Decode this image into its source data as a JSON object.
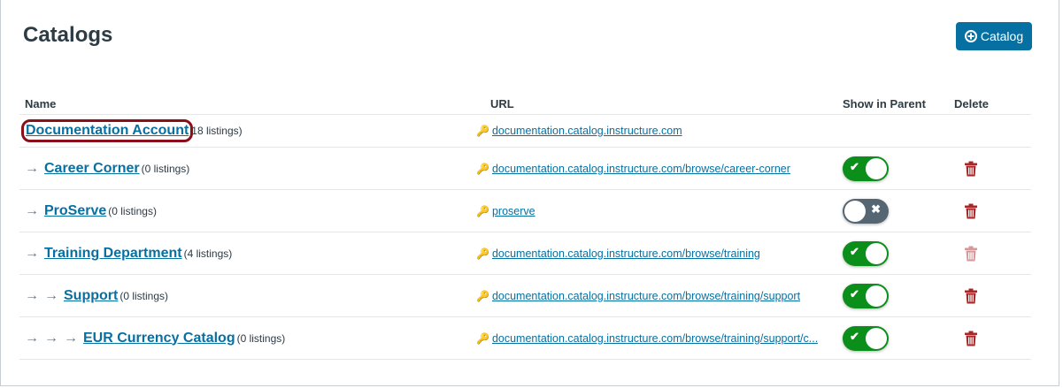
{
  "page": {
    "title": "Catalogs",
    "add_button": "Catalog"
  },
  "columns": {
    "name": "Name",
    "url": "URL",
    "show": "Show in Parent",
    "delete": "Delete"
  },
  "rows": [
    {
      "depth": 0,
      "name": "Documentation Account",
      "count": "18 listings)",
      "url": "documentation.catalog.instructure.com",
      "toggle": null,
      "delete": false
    },
    {
      "depth": 1,
      "name": "Career Corner",
      "count": "(0 listings)",
      "url": "documentation.catalog.instructure.com/browse/career-corner",
      "toggle": true,
      "delete": true
    },
    {
      "depth": 1,
      "name": "ProServe",
      "count": "(0 listings)",
      "url": "proserve",
      "toggle": false,
      "delete": true
    },
    {
      "depth": 1,
      "name": "Training Department",
      "count": "(4 listings)",
      "url": "documentation.catalog.instructure.com/browse/training",
      "toggle": true,
      "delete": "disabled"
    },
    {
      "depth": 2,
      "name": "Support",
      "count": "(0 listings)",
      "url": "documentation.catalog.instructure.com/browse/training/support",
      "toggle": true,
      "delete": true
    },
    {
      "depth": 3,
      "name": "EUR Currency Catalog",
      "count": "(0 listings)",
      "url": "documentation.catalog.instructure.com/browse/training/support/c...",
      "toggle": true,
      "delete": true
    }
  ],
  "colors": {
    "primary": "#0770a3",
    "toggle_on": "#0b8f1a",
    "toggle_off": "#556572",
    "delete": "#a5282a",
    "highlight": "#8b0f1a"
  }
}
